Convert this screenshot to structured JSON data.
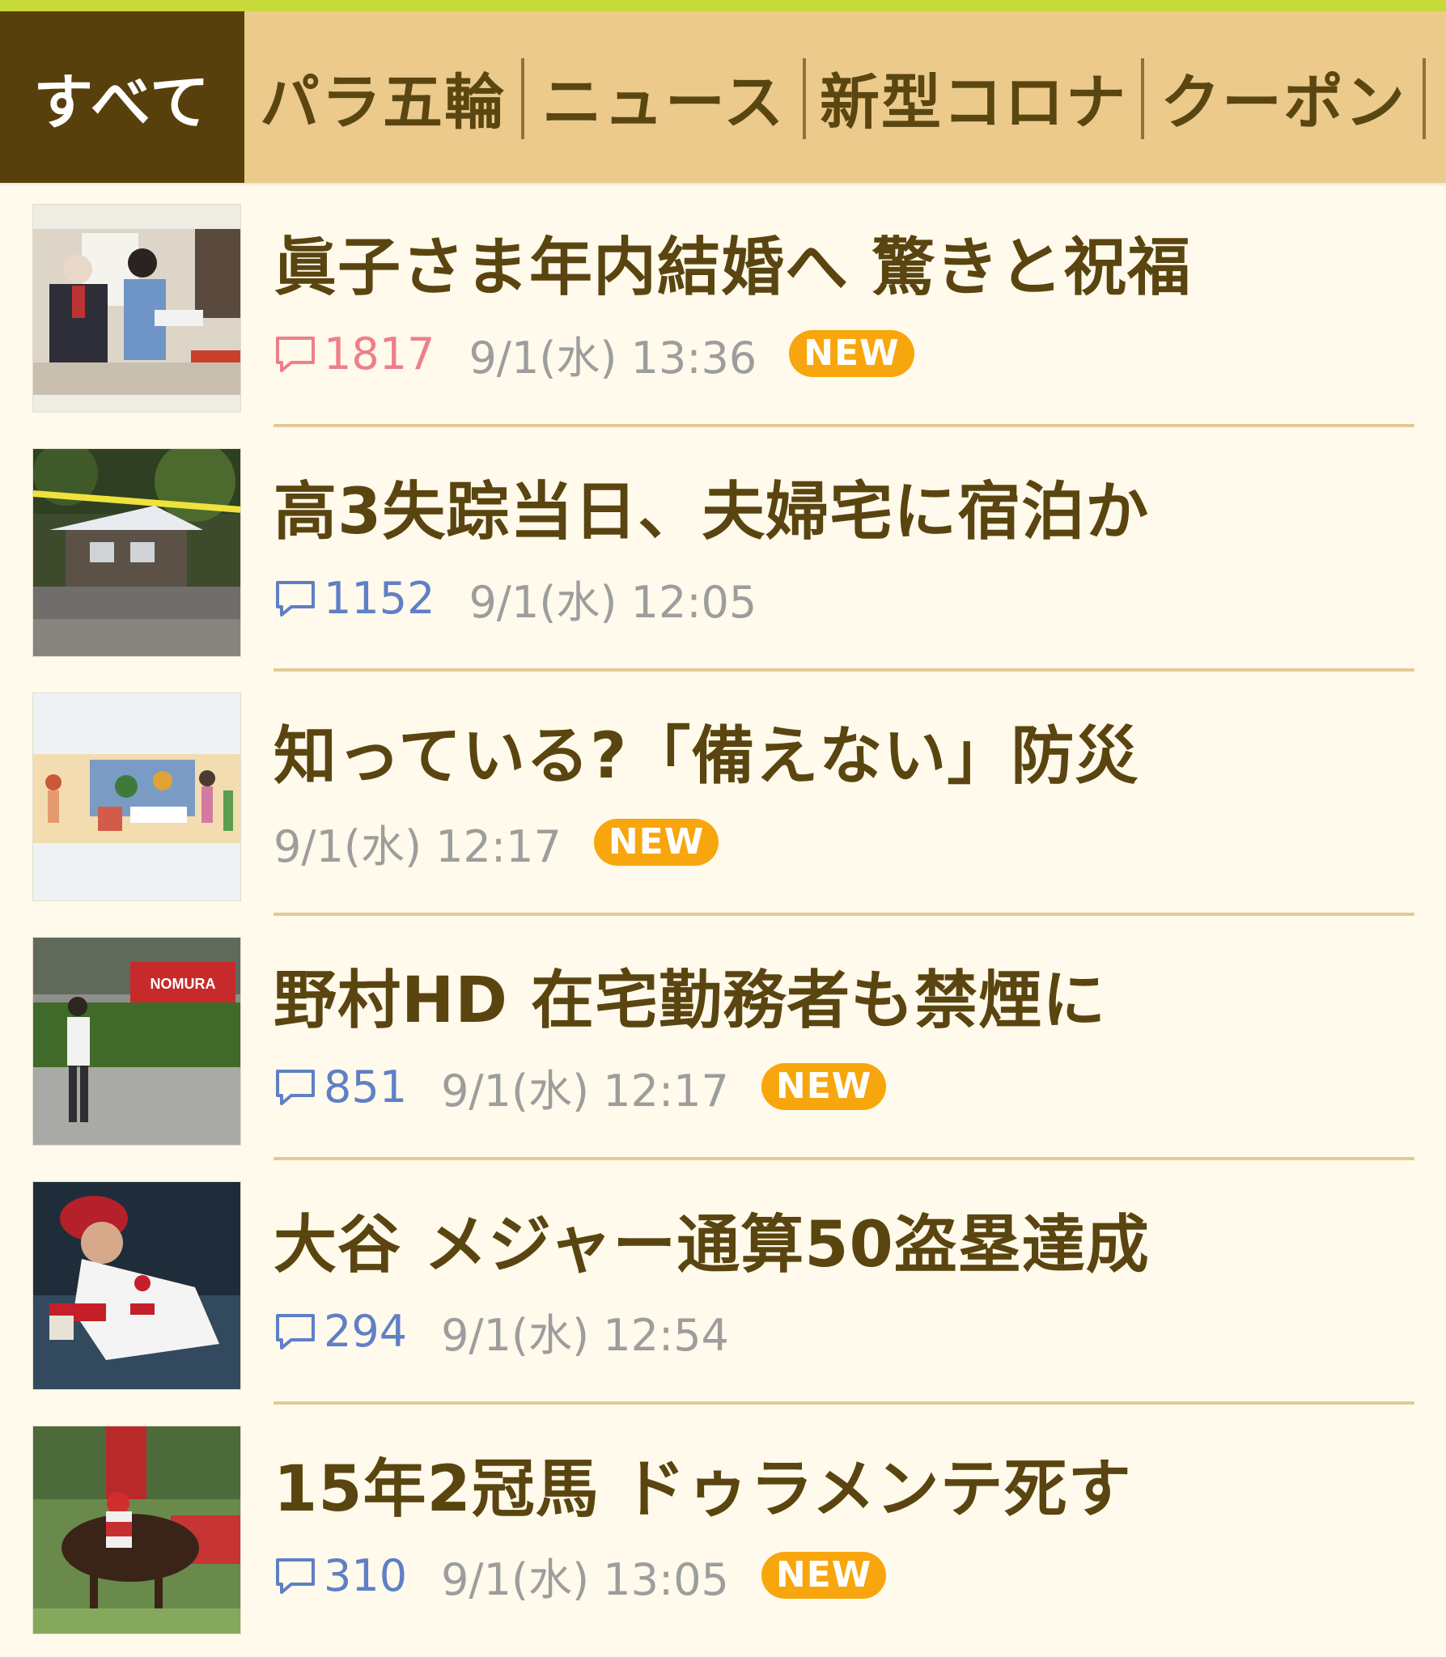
{
  "tabs": [
    {
      "label": "すべて",
      "active": true
    },
    {
      "label": "パラ五輪",
      "active": false
    },
    {
      "label": "ニュース",
      "active": false
    },
    {
      "label": "新型コロナ",
      "active": false
    },
    {
      "label": "クーポン",
      "active": false
    }
  ],
  "news": [
    {
      "headline": "眞子さま年内結婚へ 驚きと祝福",
      "comments": "1817",
      "date": "9/1(水) 13:36",
      "new_label": "NEW"
    },
    {
      "headline": "高3失踪当日、夫婦宅に宿泊か",
      "comments": "1152",
      "date": "9/1(水) 12:05"
    },
    {
      "headline": "知っている?「備えない」防災",
      "date": "9/1(水) 12:17",
      "new_label": "NEW"
    },
    {
      "headline": "野村HD 在宅勤務者も禁煙に",
      "comments": "851",
      "date": "9/1(水) 12:17",
      "new_label": "NEW",
      "thumb_sign": "NOMURA"
    },
    {
      "headline": "大谷 メジャー通算50盗塁達成",
      "comments": "294",
      "date": "9/1(水) 12:54"
    },
    {
      "headline": "15年2冠馬 ドゥラメンテ死す",
      "comments": "310",
      "date": "9/1(水) 13:05",
      "new_label": "NEW"
    }
  ],
  "colors": {
    "accent_bar": "#c8da3a",
    "tab_bg": "#ecca8c",
    "tab_active_bg": "#58400c",
    "headline": "#5a4510",
    "comment_hot": "#ee7f8a",
    "comment_cool": "#5f7fc6",
    "new_badge": "#f8a60e",
    "page_bg": "#fffaeb"
  },
  "icons": {
    "comment": "speech-bubble-icon"
  }
}
